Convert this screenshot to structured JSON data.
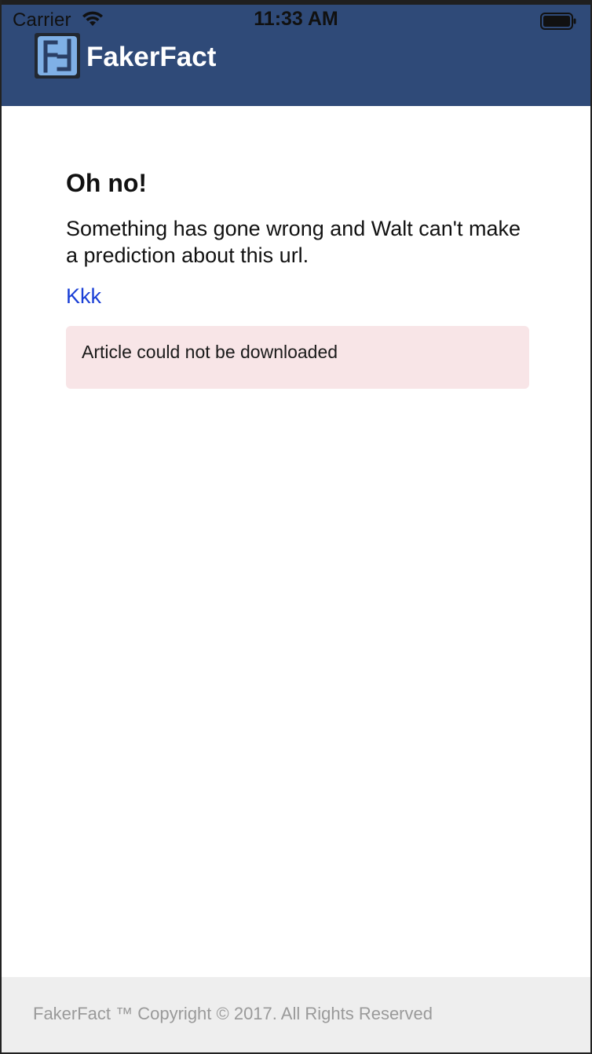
{
  "status_bar": {
    "carrier": "Carrier",
    "time": "11:33 AM",
    "wifi_icon": "wifi-icon",
    "battery_icon": "battery-icon"
  },
  "header": {
    "app_title": "FakerFact",
    "logo_icon": "fakerfact-logo-icon",
    "background_color": "#2f4a78"
  },
  "main": {
    "heading": "Oh no!",
    "message": "Something has gone wrong and Walt can't make a prediction about this url.",
    "url_link": "Kkk",
    "alert_text": "Article could not be downloaded",
    "alert_color": "#f8e5e7",
    "link_color": "#1a3fd6"
  },
  "footer": {
    "text": "FakerFact ™ Copyright © 2017. All Rights Reserved"
  }
}
